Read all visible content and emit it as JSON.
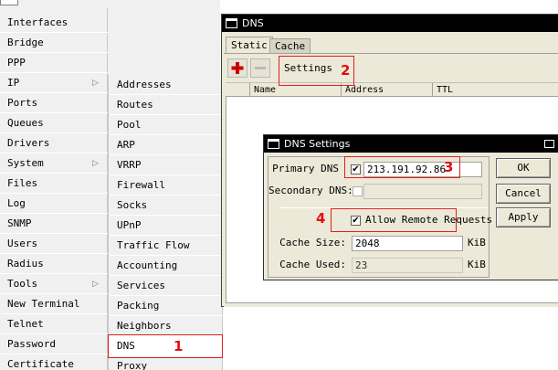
{
  "main_menu": {
    "items": [
      {
        "label": "Interfaces",
        "submenu": false
      },
      {
        "label": "Bridge",
        "submenu": false
      },
      {
        "label": "PPP",
        "submenu": false
      },
      {
        "label": "IP",
        "submenu": true
      },
      {
        "label": "Ports",
        "submenu": false
      },
      {
        "label": "Queues",
        "submenu": false
      },
      {
        "label": "Drivers",
        "submenu": false
      },
      {
        "label": "System",
        "submenu": true
      },
      {
        "label": "Files",
        "submenu": false
      },
      {
        "label": "Log",
        "submenu": false
      },
      {
        "label": "SNMP",
        "submenu": false
      },
      {
        "label": "Users",
        "submenu": false
      },
      {
        "label": "Radius",
        "submenu": false
      },
      {
        "label": "Tools",
        "submenu": true
      },
      {
        "label": "New Terminal",
        "submenu": false
      },
      {
        "label": "Telnet",
        "submenu": false
      },
      {
        "label": "Password",
        "submenu": false
      },
      {
        "label": "Certificate",
        "submenu": false
      }
    ],
    "submenu_arrow_icon": "chevron-right-icon"
  },
  "ip_submenu": {
    "items": [
      {
        "label": "Addresses"
      },
      {
        "label": "Routes"
      },
      {
        "label": "Pool"
      },
      {
        "label": "ARP"
      },
      {
        "label": "VRRP"
      },
      {
        "label": "Firewall"
      },
      {
        "label": "Socks"
      },
      {
        "label": "UPnP"
      },
      {
        "label": "Traffic Flow"
      },
      {
        "label": "Accounting"
      },
      {
        "label": "Services"
      },
      {
        "label": "Packing"
      },
      {
        "label": "Neighbors"
      },
      {
        "label": "DNS"
      },
      {
        "label": "Proxy"
      }
    ],
    "selected": "DNS"
  },
  "dns_window": {
    "title": "DNS",
    "tabs": [
      {
        "label": "Static",
        "active": true
      },
      {
        "label": "Cache",
        "active": false
      }
    ],
    "toolbar": {
      "add_icon": "plus-icon",
      "remove_icon": "minus-icon",
      "settings_label": "Settings"
    },
    "columns": [
      "",
      "Name",
      "Address",
      "TTL"
    ]
  },
  "dns_settings": {
    "title": "DNS Settings",
    "primary_dns_label": "Primary DNS",
    "primary_dns_value": "213.191.92.86",
    "primary_dns_checked": true,
    "secondary_dns_label": "Secondary DNS:",
    "secondary_dns_value": "",
    "secondary_dns_checked": false,
    "allow_remote_label": "Allow Remote Requests",
    "allow_remote_checked": true,
    "cache_size_label": "Cache Size:",
    "cache_size_value": "2048",
    "cache_size_unit": "KiB",
    "cache_used_label": "Cache Used:",
    "cache_used_value": "23",
    "cache_used_unit": "KiB",
    "ok_label": "OK",
    "cancel_label": "Cancel",
    "apply_label": "Apply"
  },
  "annotations": {
    "step1": "1",
    "step2": "2",
    "step3": "3",
    "step4": "4",
    "color": "#e01010"
  },
  "colors": {
    "window_bg": "#ece9d8",
    "titlebar": "#000000",
    "menu_bg": "#f0f0f0",
    "add_icon": "#cc0000"
  }
}
